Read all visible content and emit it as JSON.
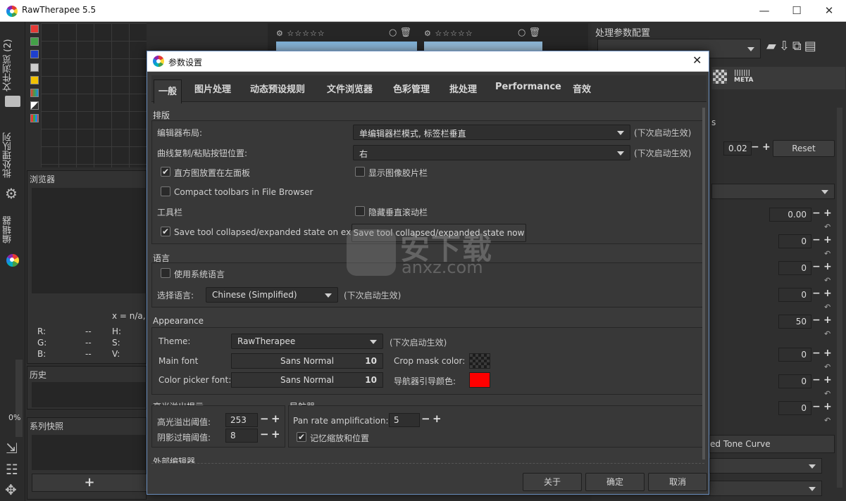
{
  "window": {
    "title": "RawTherapee 5.5",
    "minimize": "—",
    "maximize": "☐",
    "close": "✕"
  },
  "leftbar": {
    "tab_browser": "文件浏览 (2)",
    "tab_queue": "批处理队列",
    "tab_editor": "编辑器"
  },
  "left_panel": {
    "browser_header": "浏览器",
    "coord_text": "x = n/a,",
    "rgb_labels": [
      "R:",
      "G:",
      "B:"
    ],
    "rgb_values": [
      "--",
      "--",
      "--"
    ],
    "hsv_labels": [
      "H:",
      "S:",
      "V:"
    ],
    "history_header": "历史",
    "snapshots_header": "系列快照",
    "zoom_percent": "0%",
    "add_btn": "+"
  },
  "right_panel": {
    "profile_header": "处理参数配置",
    "meta_label": "META",
    "value_002": "0.02",
    "reset_label": "Reset",
    "values": [
      "0.00",
      "0",
      "0",
      "0",
      "50",
      "0",
      "0",
      "0"
    ],
    "tone_curve_text": "ed Tone Curve"
  },
  "dialog": {
    "title": "参数设置",
    "close": "✕",
    "tabs": [
      "一般",
      "图片处理",
      "动态预设规则",
      "文件浏览器",
      "色彩管理",
      "批处理",
      "Performance",
      "音效"
    ],
    "layout": {
      "header": "排版",
      "editor_layout_label": "编辑器布局:",
      "editor_layout_value": "单编辑器栏模式, 标签栏垂直",
      "editor_layout_note": "(下次启动生效)",
      "curve_btn_label": "曲线复制/粘贴按钮位置:",
      "curve_btn_value": "右",
      "curve_btn_note": "(下次启动生效)",
      "histogram_left": "直方图放置在左面板",
      "show_filmstrip": "显示图像胶片栏",
      "compact_toolbars": "Compact toolbars in File Browser",
      "toolbar_label": "工具栏",
      "hide_vscroll": "隐藏垂直滚动栏",
      "save_state_exit": "Save tool collapsed/expanded state on exit",
      "save_state_now": "Save tool collapsed/expanded state now"
    },
    "language": {
      "header": "语言",
      "use_system": "使用系统语言",
      "select_label": "选择语言:",
      "select_value": "Chinese (Simplified)",
      "note": "(下次启动生效)"
    },
    "appearance": {
      "header": "Appearance",
      "theme_label": "Theme:",
      "theme_value": "RawTherapee",
      "theme_note": "(下次启动生效)",
      "main_font_label": "Main font",
      "main_font_value": "Sans Normal",
      "main_font_size": "10",
      "picker_font_label": "Color picker font:",
      "picker_font_value": "Sans Normal",
      "picker_font_size": "10",
      "crop_mask_label": "Crop mask color:",
      "nav_color_label": "导航器引导颜色:",
      "nav_color": "#ff0000"
    },
    "clipping": {
      "header": "高光溢出提示",
      "highlight_label": "高光溢出阈值:",
      "highlight_value": "253",
      "shadow_label": "阴影过暗阈值:",
      "shadow_value": "8"
    },
    "navigator": {
      "header": "导航器",
      "pan_label": "Pan rate amplification:",
      "pan_value": "5",
      "remember_zoom": "记忆缩放和位置"
    },
    "external_editor_header": "外部编辑器",
    "buttons": {
      "about": "关于",
      "ok": "确定",
      "cancel": "取消"
    }
  },
  "watermark": {
    "text": "安下载",
    "subtext": "anxz.com"
  }
}
